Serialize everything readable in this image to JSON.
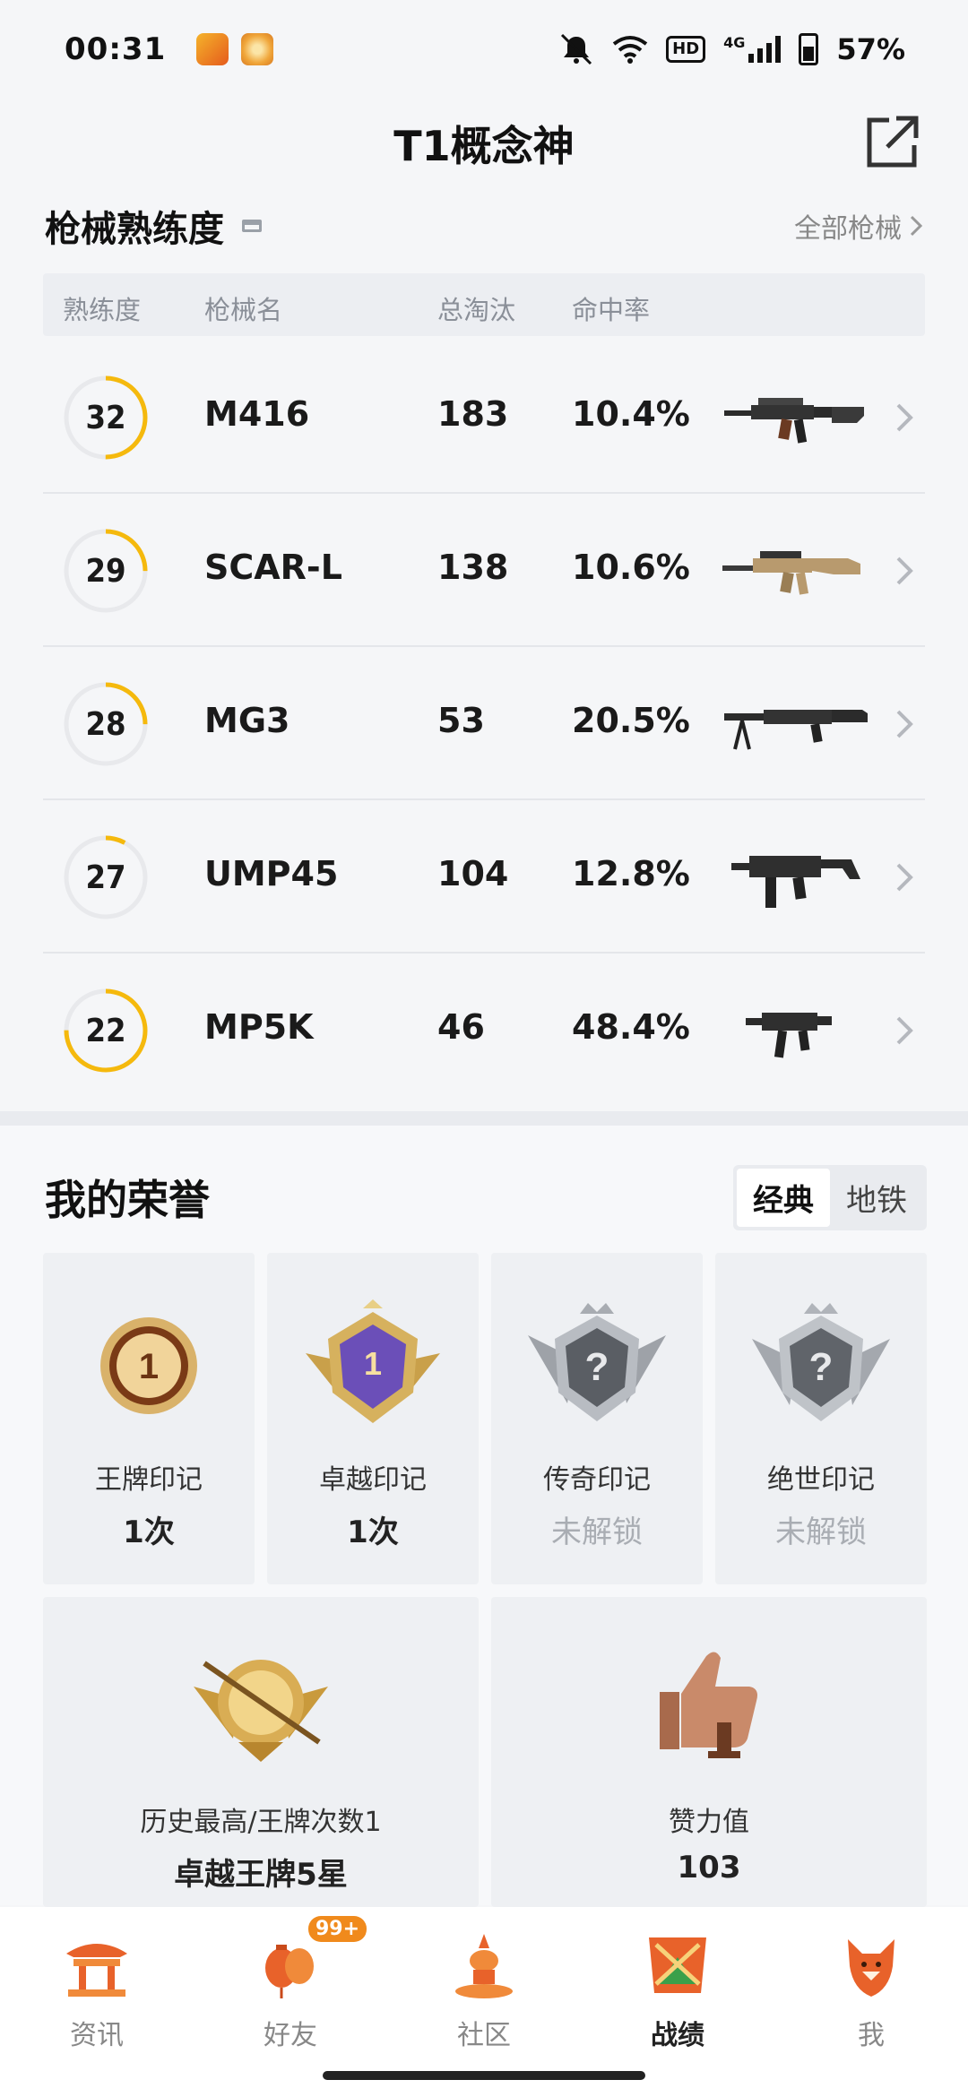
{
  "status": {
    "time": "00:31",
    "battery": "57%",
    "hd": "HD",
    "network": "4G"
  },
  "header": {
    "title": "T1概念神"
  },
  "weapons": {
    "title": "枪械熟练度",
    "all_link": "全部枪械",
    "columns": [
      "熟练度",
      "枪械名",
      "总淘汰",
      "命中率"
    ],
    "rows": [
      {
        "level": "32",
        "name": "M416",
        "kills": "183",
        "accuracy": "10.4%",
        "progress": 0.5
      },
      {
        "level": "29",
        "name": "SCAR-L",
        "kills": "138",
        "accuracy": "10.6%",
        "progress": 0.25
      },
      {
        "level": "28",
        "name": "MG3",
        "kills": "53",
        "accuracy": "20.5%",
        "progress": 0.25
      },
      {
        "level": "27",
        "name": "UMP45",
        "kills": "104",
        "accuracy": "12.8%",
        "progress": 0.08
      },
      {
        "level": "22",
        "name": "MP5K",
        "kills": "46",
        "accuracy": "48.4%",
        "progress": 0.75
      }
    ]
  },
  "honor": {
    "title": "我的荣誉",
    "tabs": [
      "经典",
      "地铁"
    ],
    "marks": [
      {
        "label": "王牌印记",
        "value": "1次",
        "locked": false
      },
      {
        "label": "卓越印记",
        "value": "1次",
        "locked": false
      },
      {
        "label": "传奇印记",
        "value": "未解锁",
        "locked": true
      },
      {
        "label": "绝世印记",
        "value": "未解锁",
        "locked": true
      }
    ],
    "best": {
      "label": "历史最高/王牌次数1",
      "value": "卓越王牌5星"
    },
    "likes": {
      "label": "赞力值",
      "value": "103"
    }
  },
  "nav": {
    "items": [
      "资讯",
      "好友",
      "社区",
      "战绩",
      "我"
    ],
    "badge": "99+",
    "active": "战绩"
  },
  "colors": {
    "ring": "#f5b90d",
    "brand": "#e86a2a",
    "badge": "#f08a1c"
  }
}
